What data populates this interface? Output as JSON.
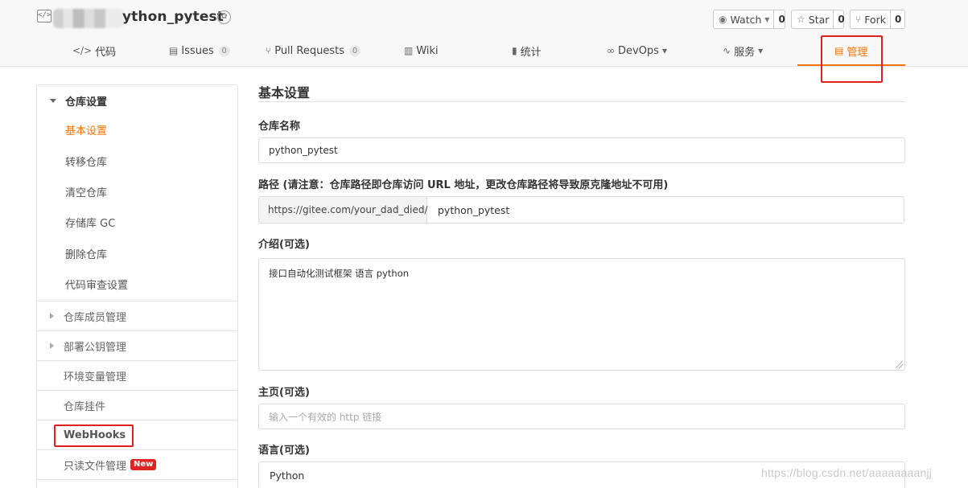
{
  "header": {
    "repo_name": "ython_pytest",
    "actions": {
      "watch": {
        "label": "Watch",
        "count": "0"
      },
      "star": {
        "label": "Star",
        "count": "0"
      },
      "fork": {
        "label": "Fork",
        "count": "0"
      }
    }
  },
  "tabs": [
    {
      "label": "代码",
      "icon": "code-icon"
    },
    {
      "label": "Issues",
      "count": "0",
      "icon": "issues-icon"
    },
    {
      "label": "Pull Requests",
      "count": "0",
      "icon": "pull-request-icon"
    },
    {
      "label": "Wiki",
      "icon": "wiki-icon"
    },
    {
      "label": "统计",
      "icon": "stats-icon"
    },
    {
      "label": "DevOps",
      "icon": "devops-icon"
    },
    {
      "label": "服务",
      "icon": "service-icon"
    },
    {
      "label": "管理",
      "icon": "manage-icon",
      "active": true
    }
  ],
  "sidebar": {
    "group": "仓库设置",
    "sub_items": [
      "基本设置",
      "转移仓库",
      "清空仓库",
      "存储库 GC",
      "删除仓库",
      "代码审查设置"
    ],
    "rows": [
      "仓库成员管理",
      "部署公钥管理",
      "环境变量管理",
      "仓库挂件",
      "WebHooks",
      "只读文件管理"
    ],
    "new_badge": "New"
  },
  "form": {
    "title": "基本设置",
    "name_label": "仓库名称",
    "name_value": "python_pytest",
    "path_label": "路径 (请注意：仓库路径即仓库访问 URL 地址，更改仓库路径将导致原克隆地址不可用)",
    "path_prefix": "https://gitee.com/your_dad_died/",
    "path_value": "python_pytest",
    "desc_label": "介绍(可选)",
    "desc_value": "接口自动化测试框架 语言 python",
    "homepage_label": "主页(可选)",
    "homepage_placeholder": "输入一个有效的 http 链接",
    "lang_label": "语言(可选)",
    "lang_value": "Python"
  },
  "watermark": "https://blog.csdn.net/aaaaaaaanjj"
}
